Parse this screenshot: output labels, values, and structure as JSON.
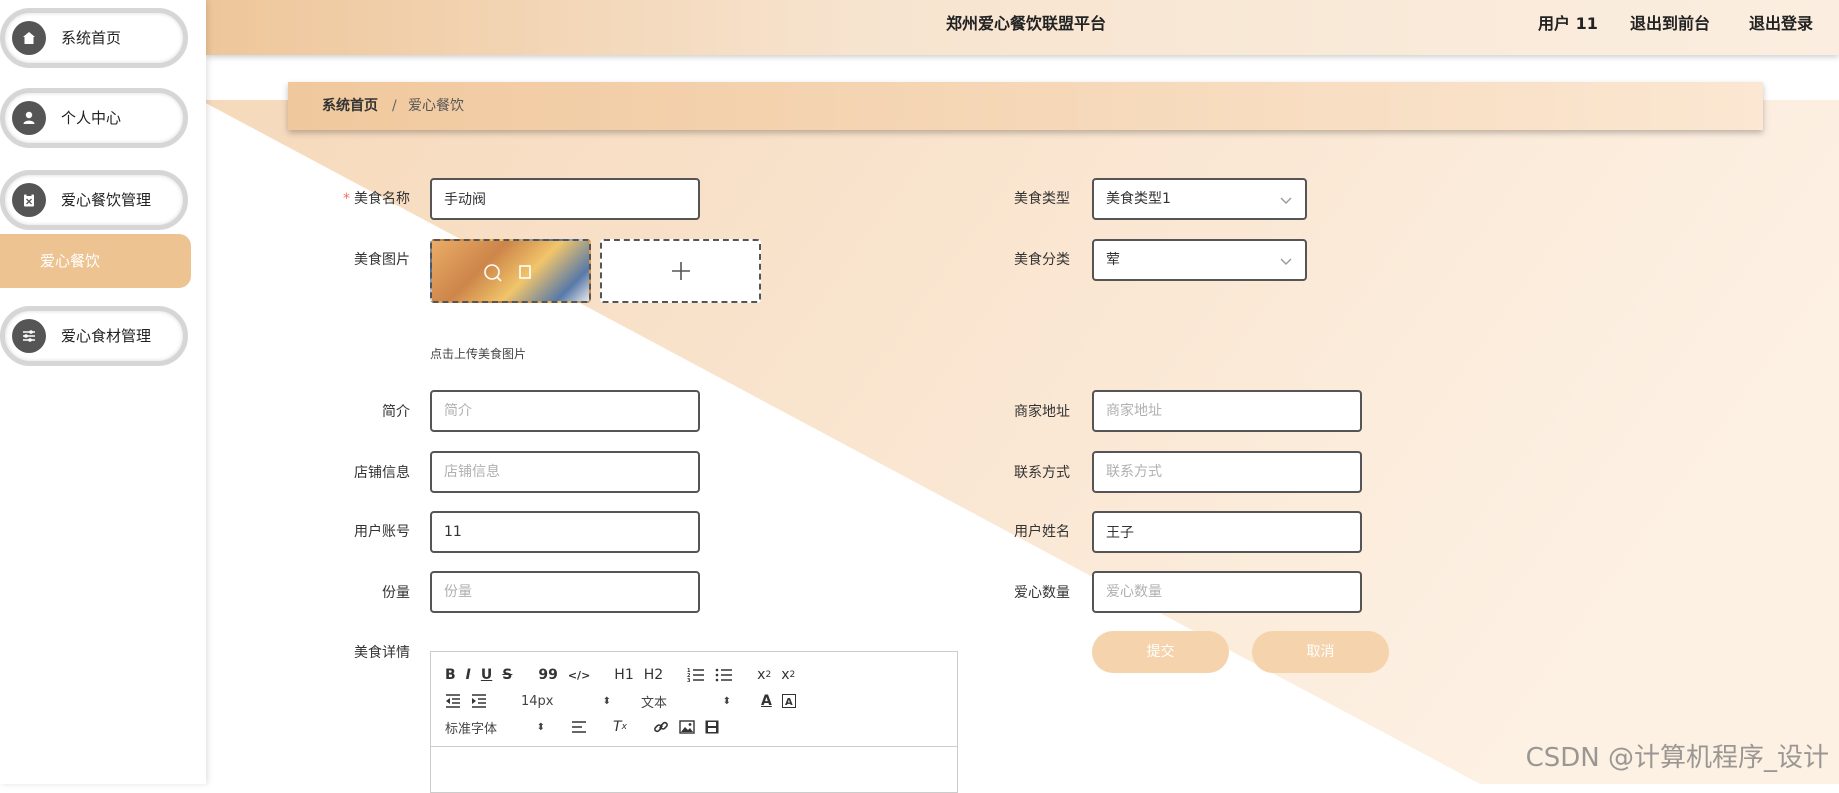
{
  "header": {
    "title": "郑州爱心餐饮联盟平台",
    "user": "用户 11",
    "to_front": "退出到前台",
    "logout": "退出登录"
  },
  "sidebar": {
    "items": [
      {
        "label": "系统首页",
        "icon": "home-icon"
      },
      {
        "label": "个人中心",
        "icon": "user-icon"
      },
      {
        "label": "爱心餐饮管理",
        "icon": "clipboard-icon"
      },
      {
        "label": "爱心食材管理",
        "icon": "sliders-icon"
      }
    ],
    "active_sub": "爱心餐饮"
  },
  "breadcrumb": {
    "home": "系统首页",
    "sep": "/",
    "current": "爱心餐饮"
  },
  "form": {
    "food_name": {
      "label": "美食名称",
      "value": "手动阀"
    },
    "food_type": {
      "label": "美食类型",
      "value": "美食类型1"
    },
    "food_image": {
      "label": "美食图片",
      "hint": "点击上传美食图片"
    },
    "food_category": {
      "label": "美食分类",
      "value": "荤"
    },
    "intro": {
      "label": "简介",
      "placeholder": "简介"
    },
    "address": {
      "label": "商家地址",
      "placeholder": "商家地址"
    },
    "shop_info": {
      "label": "店铺信息",
      "placeholder": "店铺信息"
    },
    "contact": {
      "label": "联系方式",
      "placeholder": "联系方式"
    },
    "account": {
      "label": "用户账号",
      "value": "11"
    },
    "username": {
      "label": "用户姓名",
      "value": "王子"
    },
    "portion": {
      "label": "份量",
      "placeholder": "份量"
    },
    "love_count": {
      "label": "爱心数量",
      "placeholder": "爱心数量"
    },
    "detail": {
      "label": "美食详情"
    },
    "submit": "提交",
    "cancel": "取消"
  },
  "editor": {
    "row1": [
      "B",
      "I",
      "U",
      "S",
      "99",
      "</>",
      "H1",
      "H2",
      "ordered-list",
      "bullet-list",
      "x2",
      "x2"
    ],
    "size": "14px",
    "text": "文本",
    "font": "标准字体"
  },
  "watermark": "CSDN @计算机程序_设计",
  "colors": {
    "accent": "#eec392",
    "button": "#f5d3ad",
    "required": "#f56c6c"
  }
}
